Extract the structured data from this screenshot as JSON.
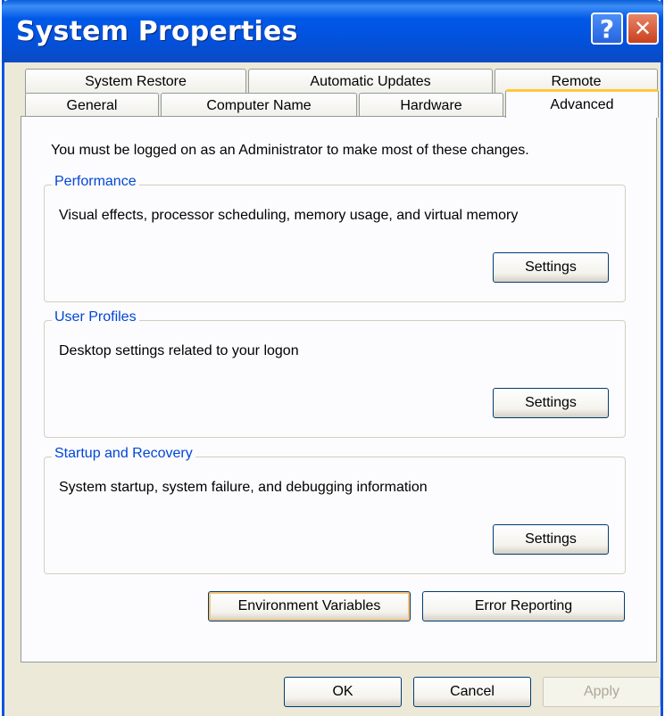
{
  "window": {
    "title": "System Properties",
    "help_glyph": "?",
    "close_glyph": "✕"
  },
  "tabs": {
    "row_back": [
      "System Restore",
      "Automatic Updates",
      "Remote"
    ],
    "row_front": [
      "General",
      "Computer Name",
      "Hardware",
      "Advanced"
    ],
    "active": "Advanced"
  },
  "advanced": {
    "admin_note": "You must be logged on as an Administrator to make most of these changes.",
    "performance": {
      "title": "Performance",
      "description": "Visual effects, processor scheduling, memory usage, and virtual memory",
      "button": "Settings"
    },
    "user_profiles": {
      "title": "User Profiles",
      "description": "Desktop settings related to your logon",
      "button": "Settings"
    },
    "startup_recovery": {
      "title": "Startup and Recovery",
      "description": "System startup, system failure, and debugging information",
      "button": "Settings"
    },
    "env_vars_button": "Environment Variables",
    "error_reporting_button": "Error Reporting"
  },
  "footer": {
    "ok": "OK",
    "cancel": "Cancel",
    "apply": "Apply"
  },
  "colors": {
    "titlebar": "#0058E8",
    "face": "#ECE9D8",
    "group_title": "#0046D5",
    "active_tab_accent": "#FFC83C"
  }
}
